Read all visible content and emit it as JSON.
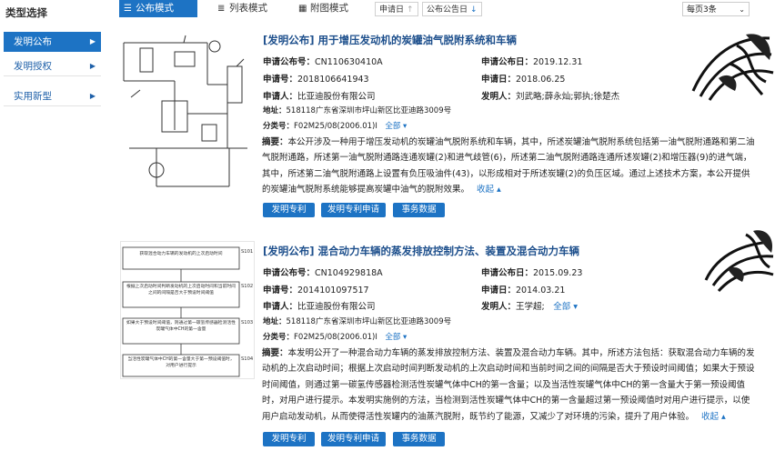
{
  "sidebar": {
    "title": "类型选择",
    "items": [
      {
        "label": "发明公布",
        "active": true
      },
      {
        "label": "发明授权",
        "active": false
      },
      {
        "label": "实用新型",
        "active": false
      }
    ]
  },
  "toolbar": {
    "views": [
      {
        "label": "公布模式",
        "icon": "list-detail-icon",
        "active": true
      },
      {
        "label": "列表模式",
        "icon": "list-icon",
        "active": false
      },
      {
        "label": "附图模式",
        "icon": "grid-icon",
        "active": false
      }
    ],
    "sort": [
      {
        "label": "申请日",
        "arrow": "↑",
        "active": false
      },
      {
        "label": "公布公告日",
        "arrow": "↓",
        "active": true
      }
    ],
    "per_page": "每页3条",
    "accent": "#1d73c4"
  },
  "results": [
    {
      "title": "[发明公布] 用于增压发动机的炭罐油气脱附系统和车辆",
      "pub_no_label": "申请公布号：",
      "pub_no": "CN110630410A",
      "pub_date_label": "申请公布日：",
      "pub_date": "2019.12.31",
      "app_no_label": "申请号：",
      "app_no": "2018106641943",
      "app_date_label": "申请日：",
      "app_date": "2018.06.25",
      "applicant_label": "申请人：",
      "applicant": "比亚迪股份有限公司",
      "inventor_label": "发明人：",
      "inventor": "刘武略;薛永灿;郭执;徐楚杰",
      "inventor_more": "",
      "address_label": "地址：",
      "address": "518118广东省深圳市坪山新区比亚迪路3009号",
      "class_label": "分类号：",
      "class_no": "F02M25/08(2006.01)I",
      "class_more": "全部 ▾",
      "abstract_label": "摘要：",
      "abstract": "本公开涉及一种用于增压发动机的炭罐油气脱附系统和车辆，其中，所述炭罐油气脱附系统包括第一油气脱附通路和第二油气脱附通路，所述第一油气脱附通路连通炭罐(2)和进气歧管(6)，所述第二油气脱附通路连通所述炭罐(2)和增压器(9)的进气端，其中，所述第二油气脱附通路上设置有负压吸油件(43)，以形成相对于所述炭罐(2)的负压区域。通过上述技术方案，本公开提供的炭罐油气脱附系统能够提高炭罐中油气的脱附效果。",
      "collapse": "收起 ▴",
      "buttons": [
        "发明专利",
        "发明专利申请",
        "事务数据"
      ]
    },
    {
      "title": "[发明公布] 混合动力车辆的蒸发排放控制方法、装置及混合动力车辆",
      "pub_no_label": "申请公布号：",
      "pub_no": "CN104929818A",
      "pub_date_label": "申请公布日：",
      "pub_date": "2015.09.23",
      "app_no_label": "申请号：",
      "app_no": "2014101097517",
      "app_date_label": "申请日：",
      "app_date": "2014.03.21",
      "applicant_label": "申请人：",
      "applicant": "比亚迪股份有限公司",
      "inventor_label": "发明人：",
      "inventor": "王学超;",
      "inventor_more": "全部 ▾",
      "address_label": "地址：",
      "address": "518118广东省深圳市坪山新区比亚迪路3009号",
      "class_label": "分类号：",
      "class_no": "F02M25/08(2006.01)I",
      "class_more": "全部 ▾",
      "abstract_label": "摘要：",
      "abstract": "本发明公开了一种混合动力车辆的蒸发排放控制方法、装置及混合动力车辆。其中，所述方法包括：获取混合动力车辆的发动机的上次启动时间；根据上次启动时间判断发动机的上次启动时间和当前时间之间的间隔是否大于预设时间阈值；如果大于预设时间阈值，则通过第一碳氢传感器检测活性炭罐气体中CH的第一含量；以及当活性炭罐气体中CH的第一含量大于第一预设阈值时，对用户进行提示。本发明实施例的方法，当检测到活性炭罐气体中CH的第一含量超过第一预设阈值时对用户进行提示，以使用户启动发动机，从而使得活性炭罐内的油蒸汽脱附，既节约了能源，又减少了对环境的污染，提升了用户体验。",
      "collapse": "收起 ▴",
      "buttons": [
        "发明专利",
        "发明专利申请",
        "事务数据"
      ]
    }
  ],
  "flowchart": {
    "steps": [
      {
        "label": "S101",
        "text": "获取混合动力车辆的发动机的上次启动时间"
      },
      {
        "label": "S102",
        "text": "根据上次启动时间判断发动机的上次启动时间和当前时间之间的间隔是否大于预设时间阈值"
      },
      {
        "label": "S103",
        "text": "如果大于预设时间阈值，则通过第一碳氢传感器检测活性炭罐气体中CH的第一含量"
      },
      {
        "label": "S104",
        "text": "当活性炭罐气体中CH的第一含量大于第一预设阈值时，对用户进行提示"
      }
    ]
  }
}
